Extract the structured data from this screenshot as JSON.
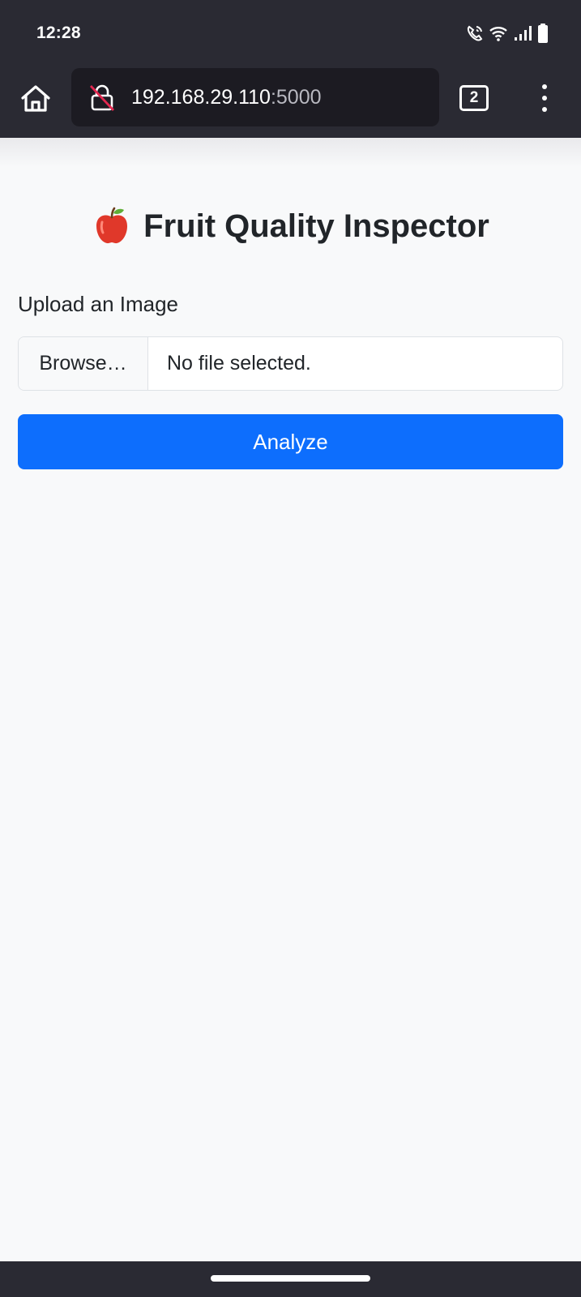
{
  "status_bar": {
    "time": "12:28",
    "icons": [
      "wifi-calling-icon",
      "wifi-icon",
      "signal-icon",
      "battery-icon"
    ]
  },
  "browser": {
    "home_icon": "home-icon",
    "lock_icon": "insecure-lock-icon",
    "url_host": "192.168.29.110",
    "url_port": ":5000",
    "tab_count": "2",
    "menu_icon": "more-vertical-icon"
  },
  "page": {
    "title": "Fruit Quality Inspector",
    "title_icon": "apple-icon",
    "upload_label": "Upload an Image",
    "file_input": {
      "browse_label": "Browse…",
      "status_text": "No file selected."
    },
    "analyze_label": "Analyze"
  },
  "colors": {
    "chrome_bg": "#2a2a33",
    "url_bar_bg": "#1c1b22",
    "page_bg": "#f8f9fa",
    "primary": "#0d6efd",
    "text": "#212529"
  }
}
